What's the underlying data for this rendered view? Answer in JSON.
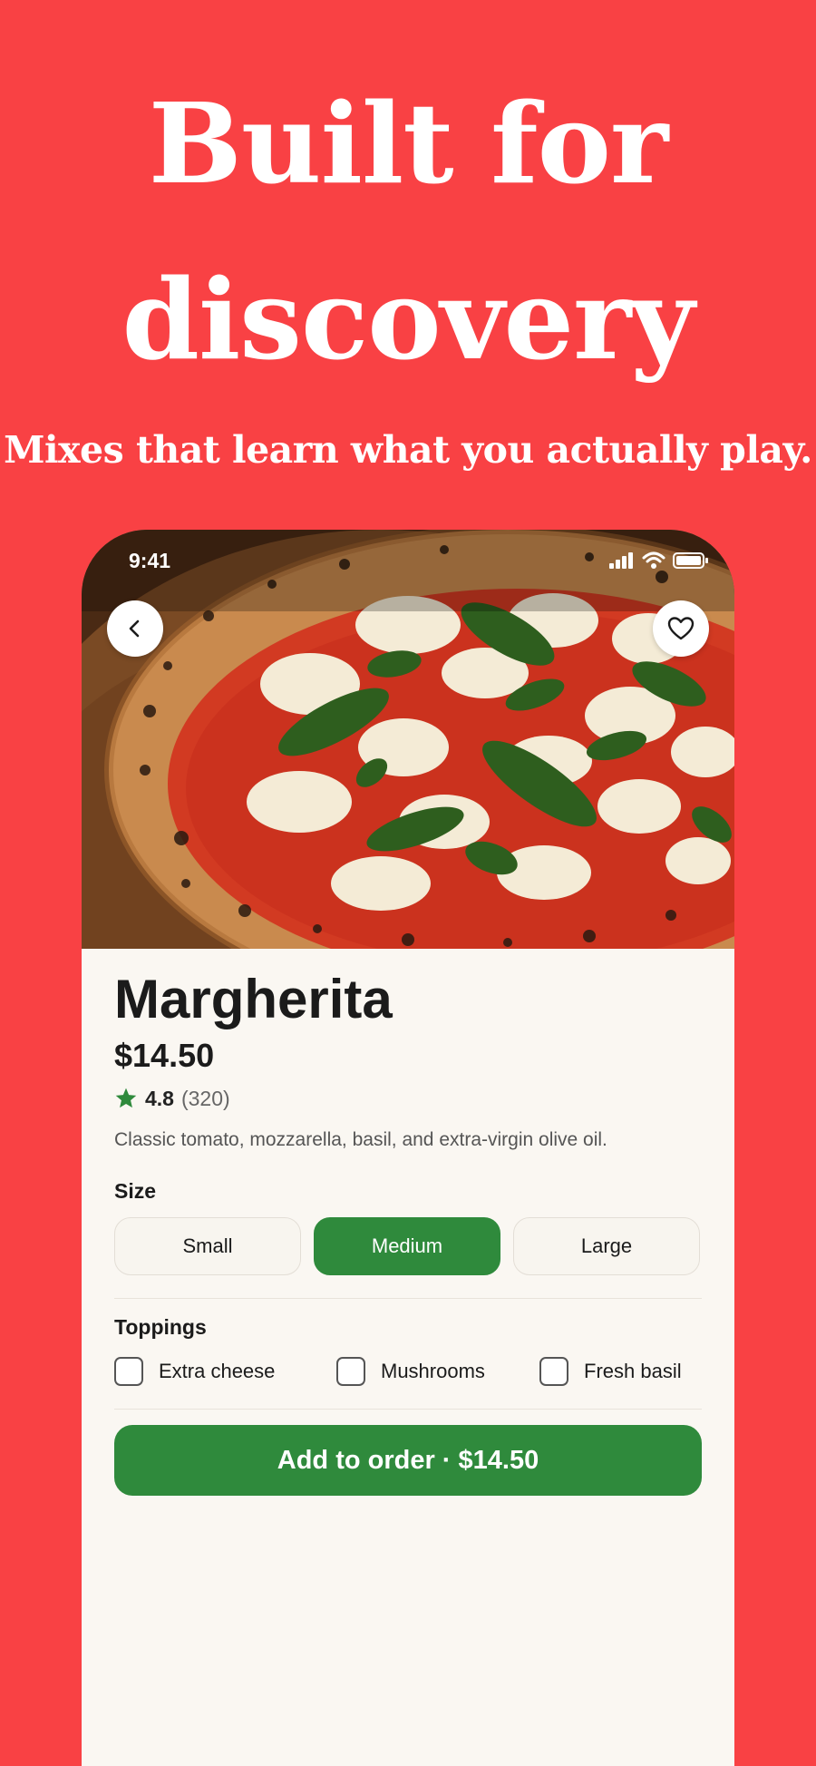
{
  "colors": {
    "background": "#F94144",
    "accent_green": "#2F8A3C",
    "surface": "#FAF7F2"
  },
  "hero": {
    "headline_line1": "Built for",
    "headline_line2": "discovery",
    "tagline": "Mixes that learn what you actually play."
  },
  "status_bar": {
    "time": "9:41",
    "icons": [
      "signal-icon",
      "wifi-icon",
      "battery-icon"
    ]
  },
  "nav": {
    "back_icon": "chevron-left-icon",
    "favorite_icon": "heart-icon"
  },
  "product": {
    "image": "margherita-pizza-photo",
    "name": "Margherita",
    "price": "$14.50",
    "rating": "4.8",
    "rating_count": "(320)",
    "rating_icon": "star-icon",
    "description": "Classic tomato, mozzarella, basil, and extra-virgin olive oil."
  },
  "size": {
    "label": "Size",
    "options": [
      "Small",
      "Medium",
      "Large"
    ],
    "selected": "Medium"
  },
  "toppings": {
    "label": "Toppings",
    "options": [
      {
        "label": "Extra cheese",
        "checked": false
      },
      {
        "label": "Mushrooms",
        "checked": false
      },
      {
        "label": "Fresh basil",
        "checked": false
      }
    ]
  },
  "cta": {
    "label": "Add to order · $14.50"
  }
}
